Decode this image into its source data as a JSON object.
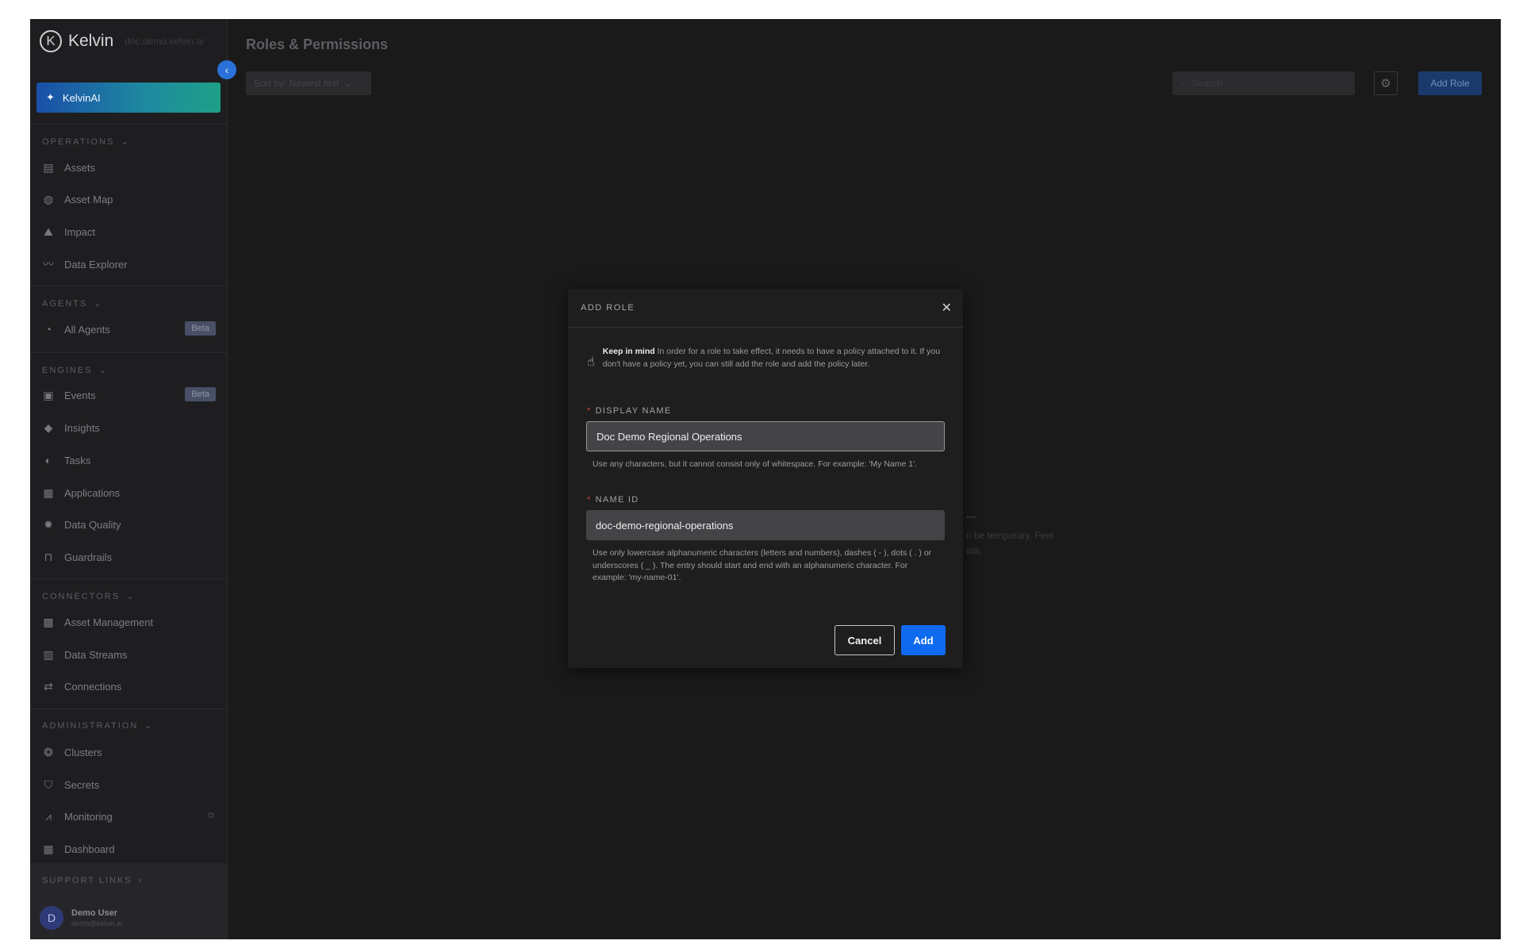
{
  "sidebar": {
    "brand": "Kelvin",
    "environment": "doc.demo.kelvin.ai",
    "kelvin_ai": "KelvinAI",
    "sections": {
      "operations": "OPERATIONS",
      "agents": "AGENTS",
      "engines": "ENGINES",
      "connectors": "CONNECTORS",
      "administration": "ADMINISTRATION",
      "support": "SUPPORT LINKS"
    },
    "items": {
      "assets": "Assets",
      "asset_map": "Asset Map",
      "impact": "Impact",
      "data_explorer": "Data Explorer",
      "all_agents": "All Agents",
      "events": "Events",
      "insights": "Insights",
      "tasks": "Tasks",
      "applications": "Applications",
      "data_quality": "Data Quality",
      "guardrails": "Guardrails",
      "asset_management": "Asset Management",
      "data_streams": "Data Streams",
      "connections": "Connections",
      "clusters": "Clusters",
      "secrets": "Secrets",
      "monitoring": "Monitoring",
      "dashboard": "Dashboard"
    },
    "badge_beta": "Beta",
    "user": {
      "initial": "D",
      "name": "Demo User",
      "email": "demo@kelvin.ai"
    }
  },
  "main": {
    "title": "Roles & Permissions",
    "sort_label": "Sort by: Newest first",
    "search_placeholder": "Search",
    "add_role_label": "Add Role",
    "empty_title": "...",
    "empty_line1": "n be temporary. Feel",
    "empty_line2": "ata."
  },
  "modal": {
    "title": "ADD ROLE",
    "info_strong": "Keep in mind",
    "info_text": " In order for a role to take effect, it needs to have a policy attached to it. If you don't have a policy yet, you can still add the role and add the policy later.",
    "display_name_label": "DISPLAY NAME",
    "display_name_value": "Doc Demo Regional Operations",
    "display_name_help": "Use any characters, but it cannot consist only of whitespace. For example: 'My Name 1'.",
    "name_id_label": "NAME ID",
    "name_id_value": "doc-demo-regional-operations",
    "name_id_help": "Use only lowercase alphanumeric characters (letters and numbers), dashes ( - ), dots ( . ) or underscores ( _ ). The entry should start and end with an alphanumeric character. For example: 'my-name-01'.",
    "cancel_label": "Cancel",
    "add_label": "Add"
  },
  "colors": {
    "primary": "#0f6af0",
    "required": "#d14343",
    "overlay_bg": "#1a1a1b"
  }
}
